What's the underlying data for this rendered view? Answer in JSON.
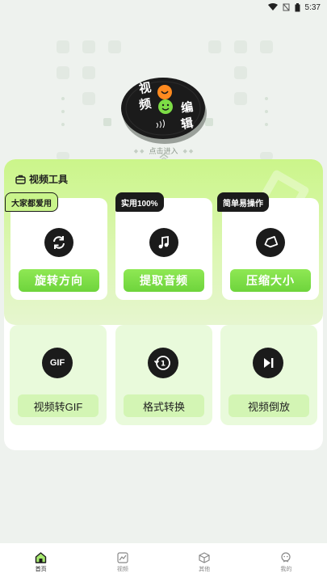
{
  "status_bar": {
    "time": "5:37"
  },
  "hero": {
    "title_chars": [
      "视",
      "频",
      "编",
      "辑"
    ],
    "enter_hint": "点击进入"
  },
  "tools": {
    "section_title": "视频工具",
    "featured": [
      {
        "tag": "大家都爱用",
        "label": "旋转方向",
        "icon": "rotate-icon"
      },
      {
        "tag": "实用100%",
        "label": "提取音频",
        "icon": "music-note-icon"
      },
      {
        "tag": "简单易操作",
        "label": "压缩大小",
        "icon": "compress-icon"
      }
    ],
    "more": [
      {
        "label": "视频转GIF",
        "icon": "gif-icon",
        "icon_text": "GIF"
      },
      {
        "label": "格式转换",
        "icon": "format-convert-icon"
      },
      {
        "label": "视频倒放",
        "icon": "reverse-play-icon"
      }
    ]
  },
  "nav": [
    {
      "label": "首页",
      "icon": "home-icon",
      "active": true
    },
    {
      "label": "视频",
      "icon": "chart-icon",
      "active": false
    },
    {
      "label": "其他",
      "icon": "cube-icon",
      "active": false
    },
    {
      "label": "我的",
      "icon": "profile-icon",
      "active": false
    }
  ],
  "colors": {
    "accent": "#7ddc46",
    "dark": "#1b1b1b",
    "background": "#eef2ee"
  }
}
